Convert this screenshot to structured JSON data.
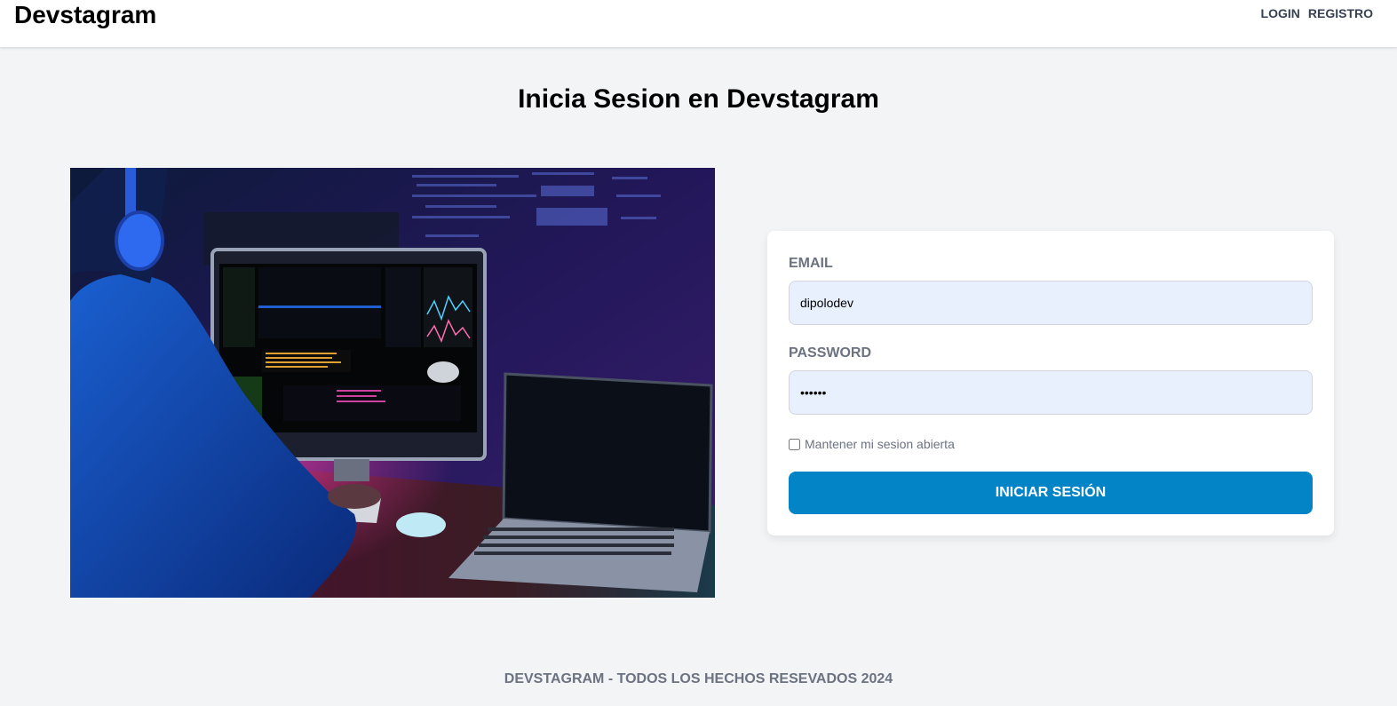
{
  "header": {
    "brand": "Devstagram",
    "nav": {
      "login": "LOGIN",
      "register": "REGISTRO"
    }
  },
  "main": {
    "title": "Inicia Sesion en Devstagram",
    "hero_image": {
      "description_icon": "developer-workstation-image"
    },
    "form": {
      "email_label": "EMAIL",
      "email_value": "dipolodev",
      "password_label": "PASSWORD",
      "password_value": "••••••",
      "remember_label": "Mantener mi sesion abierta",
      "remember_checked": false,
      "submit_label": "INICIAR SESIÓN"
    }
  },
  "footer": {
    "text": "DEVSTAGRAM - TODOS LOS HECHOS RESEVADOS 2024"
  },
  "colors": {
    "page_bg": "#f3f4f6",
    "accent": "#0284c7",
    "input_bg": "#e8f0fe",
    "muted_text": "#6b7280"
  }
}
